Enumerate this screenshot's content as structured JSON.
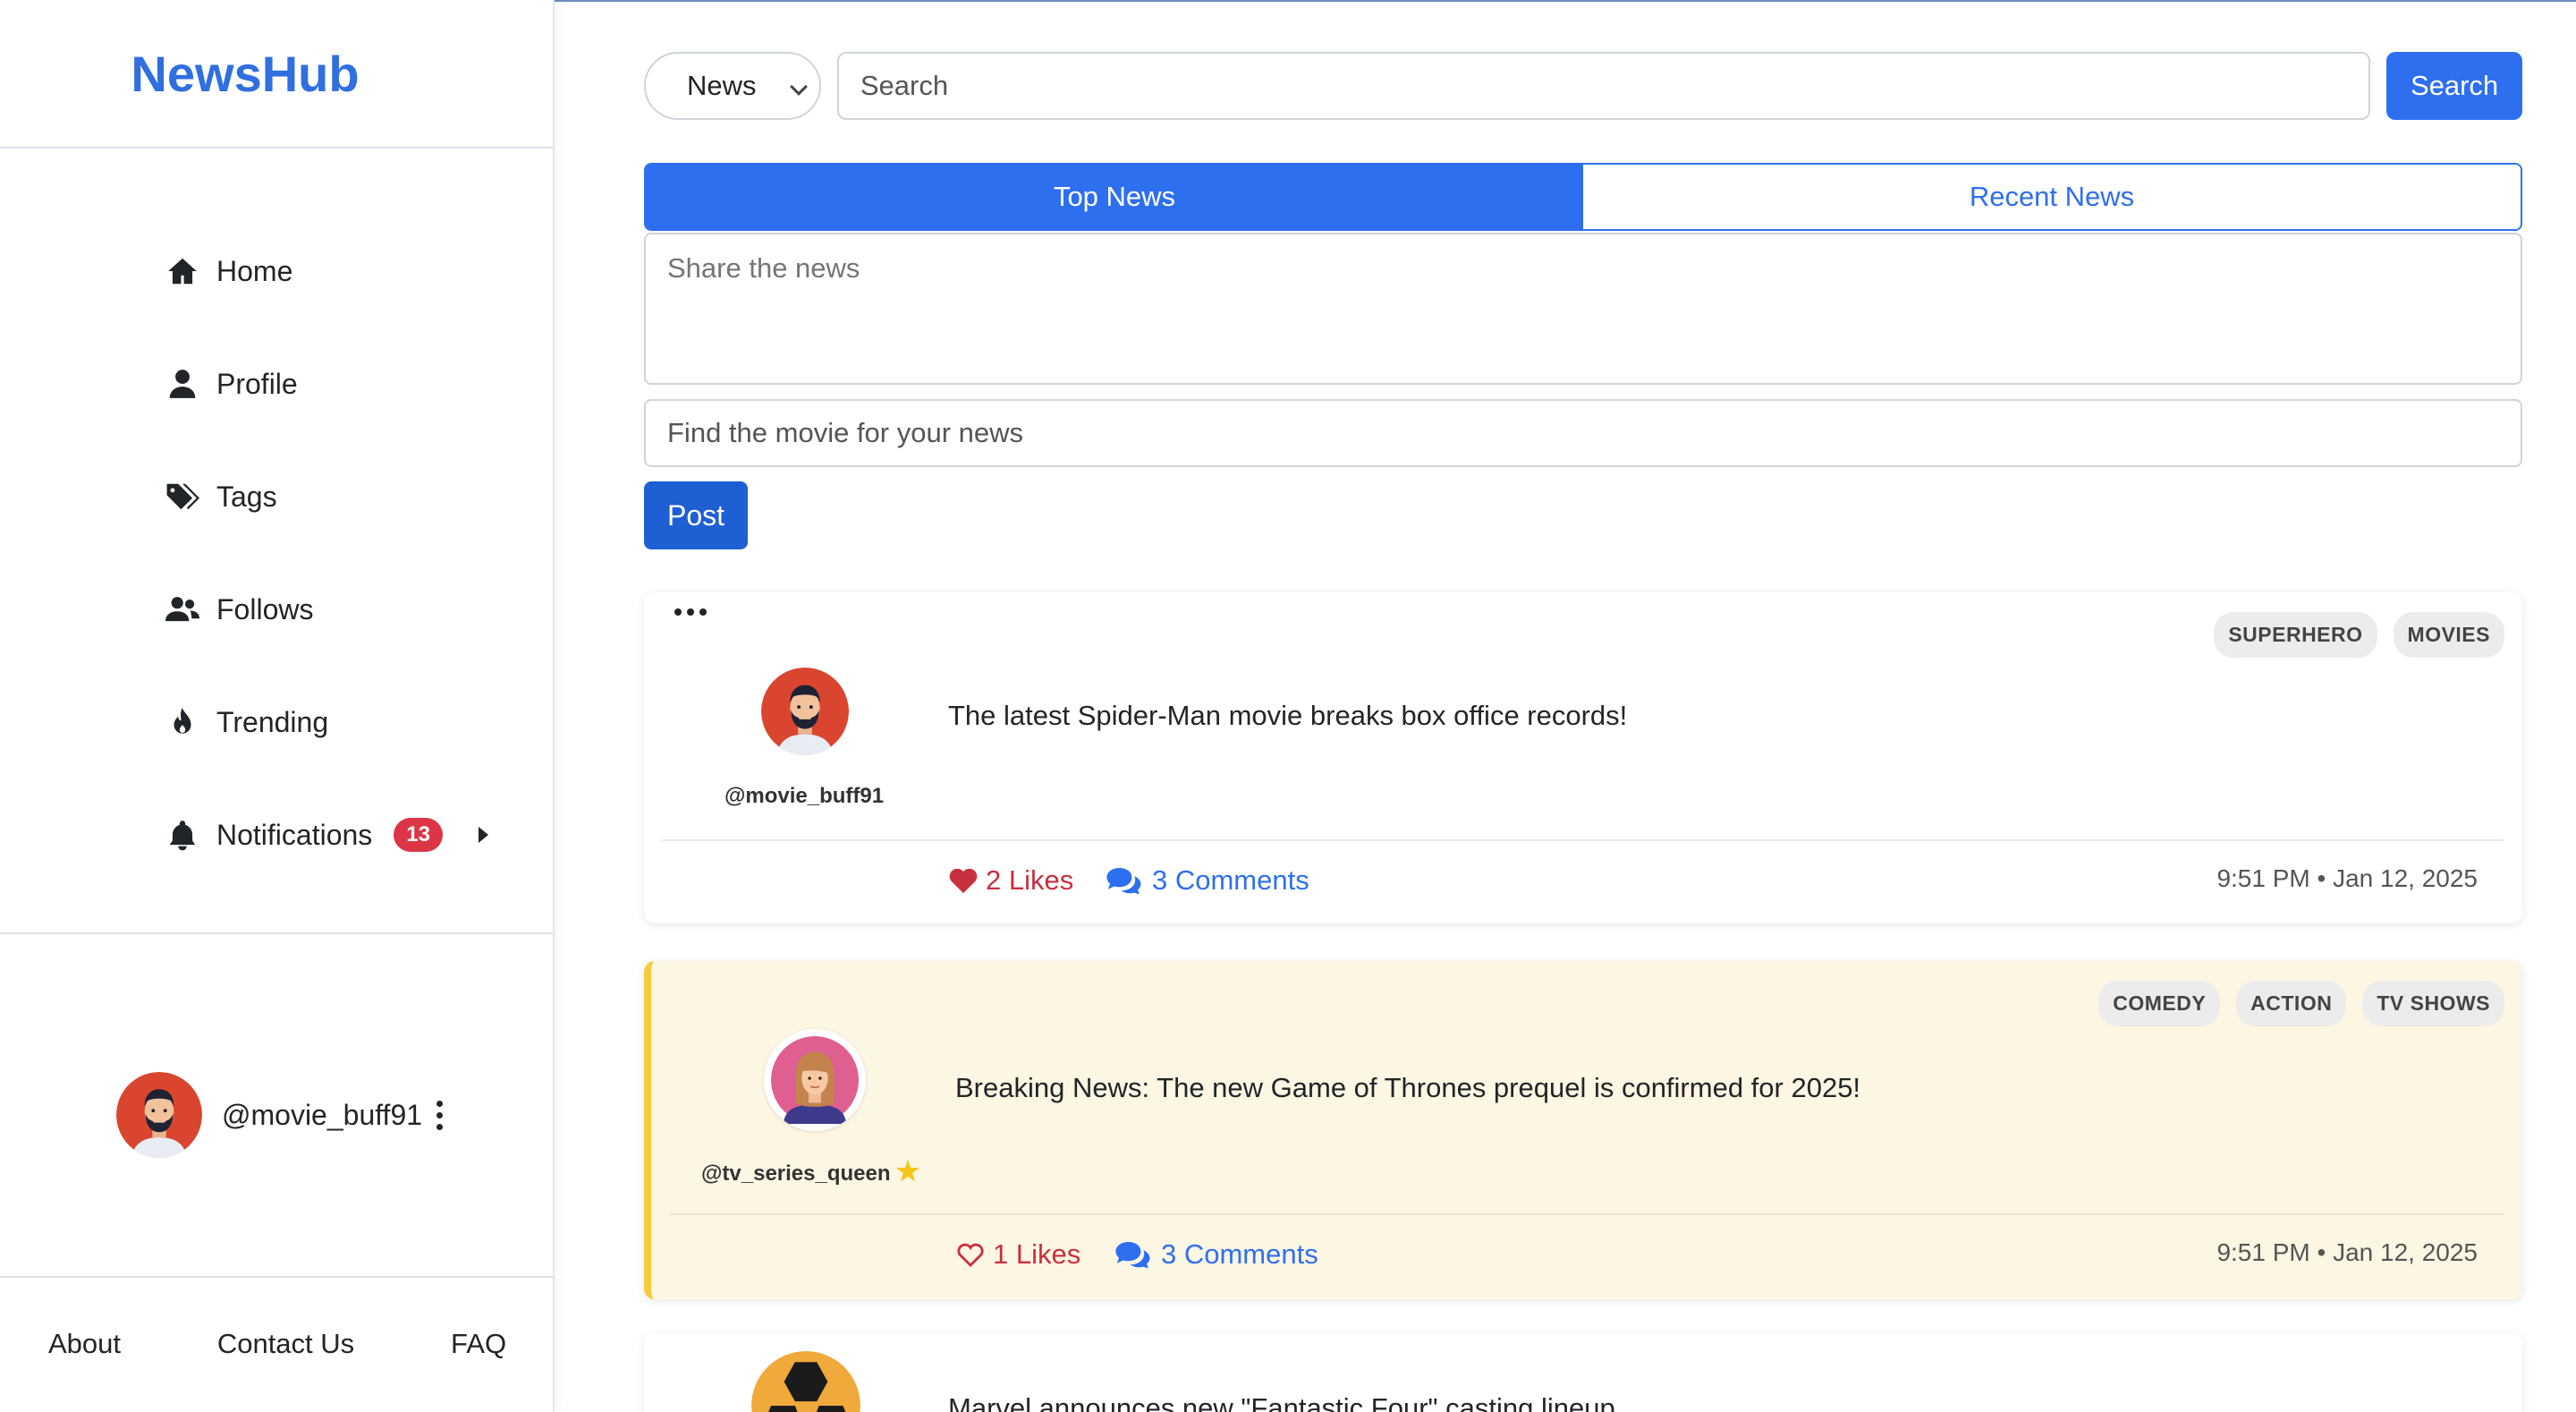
{
  "app": {
    "brand": "NewsHub"
  },
  "sidebar": {
    "items": [
      {
        "label": "Home",
        "icon": "home-icon"
      },
      {
        "label": "Profile",
        "icon": "user-icon"
      },
      {
        "label": "Tags",
        "icon": "tags-icon"
      },
      {
        "label": "Follows",
        "icon": "users-icon"
      },
      {
        "label": "Trending",
        "icon": "fire-icon"
      },
      {
        "label": "Notifications",
        "icon": "bell-icon",
        "badge": "13"
      }
    ],
    "user": {
      "handle": "@movie_buff91"
    },
    "footer": {
      "about": "About",
      "contact": "Contact Us",
      "faq": "FAQ"
    }
  },
  "search": {
    "category": "News",
    "placeholder": "Search",
    "button": "Search"
  },
  "tabs": [
    {
      "label": "Top News",
      "active": true
    },
    {
      "label": "Recent News",
      "active": false
    }
  ],
  "compose": {
    "placeholder": "Share the news",
    "movie_placeholder": "Find the movie for your news",
    "post_button": "Post"
  },
  "posts": [
    {
      "user": "@movie_buff91",
      "text": "The latest Spider-Man movie breaks box office records!",
      "tags": [
        "SUPERHERO",
        "MOVIES"
      ],
      "likes": "2 Likes",
      "liked": true,
      "comments": "3 Comments",
      "time": "9:51 PM • Jan 12, 2025"
    },
    {
      "user": "@tv_series_queen",
      "text": "Breaking News: The new Game of Thrones prequel is confirmed for 2025!",
      "tags": [
        "COMEDY",
        "ACTION",
        "TV SHOWS"
      ],
      "likes": "1 Likes",
      "liked": false,
      "comments": "3 Comments",
      "time": "9:51 PM • Jan 12, 2025",
      "featured": true,
      "badge_icon": "star-icon"
    },
    {
      "text": "Marvel announces new \"Fantastic Four\" casting lineup"
    }
  ],
  "colors": {
    "primary": "#2e6ff0",
    "danger": "#dc3545",
    "featured_bg": "#fdf6e3",
    "featured_border": "#f5cc3c"
  }
}
